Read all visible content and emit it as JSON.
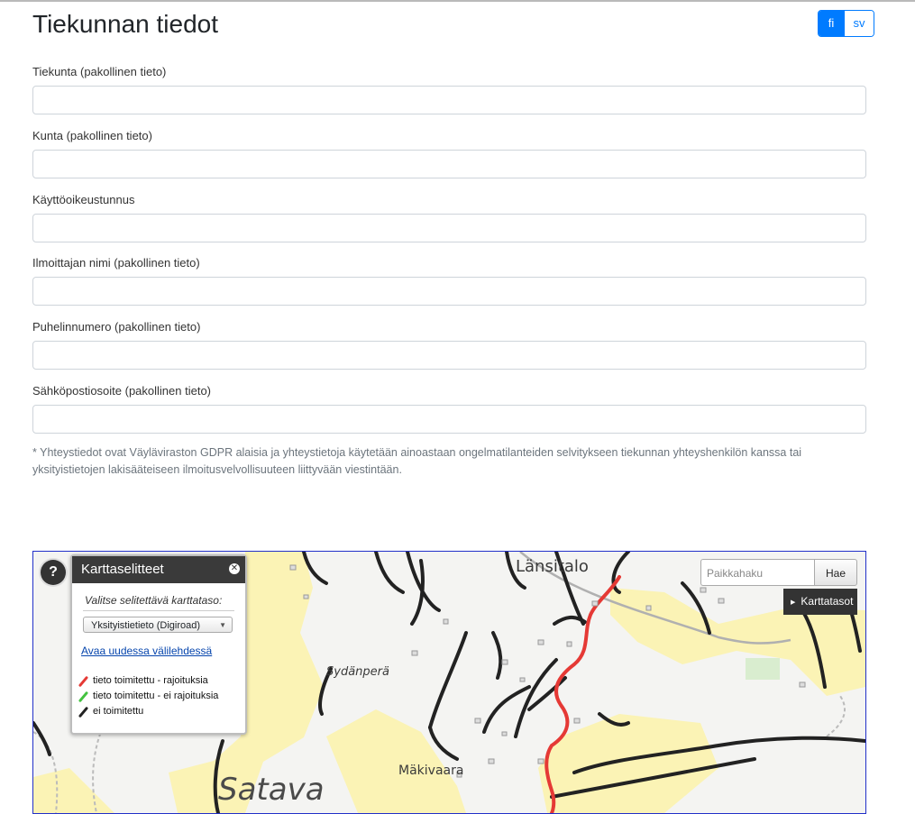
{
  "page": {
    "title": "Tiekunnan tiedot",
    "languages": {
      "active": "fi",
      "other": "sv"
    }
  },
  "form": {
    "fields": [
      {
        "label": "Tiekunta (pakollinen tieto)",
        "value": ""
      },
      {
        "label": "Kunta (pakollinen tieto)",
        "value": ""
      },
      {
        "label": "Käyttöoikeustunnus",
        "value": ""
      },
      {
        "label": "Ilmoittajan nimi (pakollinen tieto)",
        "value": ""
      },
      {
        "label": "Puhelinnumero (pakollinen tieto)",
        "value": ""
      },
      {
        "label": "Sähköpostiosoite (pakollinen tieto)",
        "value": ""
      }
    ],
    "note": "* Yhteystiedot ovat Väyläviraston GDPR alaisia ja yhteystietoja käytetään ainoastaan ongelmatilanteiden selvitykseen tiekunnan yhteyshenkilön kanssa tai yksityistietojen lakisääteiseen ilmoitusvelvollisuuteen liittyvään viestintään."
  },
  "map": {
    "help_label": "?",
    "legend": {
      "title": "Karttaselitteet",
      "prompt": "Valitse selitettävä karttataso:",
      "selected_layer": "Yksityistietieto (Digiroad)",
      "open_link": "Avaa uudessa välilehdessä",
      "items": [
        {
          "label": "tieto toimitettu - rajoituksia",
          "color": "#e53935"
        },
        {
          "label": "tieto toimitettu - ei rajoituksia",
          "color": "#43c23f"
        },
        {
          "label": "ei toimitettu",
          "color": "#222222"
        }
      ]
    },
    "search": {
      "placeholder": "Paikkahaku",
      "button": "Hae"
    },
    "layers_button": "Karttatasot",
    "places": {
      "p1": "Länsitalo",
      "p2": "Sydänperä",
      "p3": "Mäkivaara",
      "p4": "Satava"
    },
    "colors": {
      "land": "#f4f4f2",
      "field": "#fbf3b5",
      "road_unreported": "#222222",
      "road_restricted": "#e53935"
    }
  }
}
